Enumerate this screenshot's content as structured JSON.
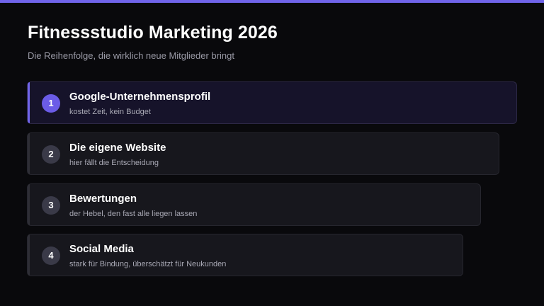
{
  "header": {
    "title": "Fitnessstudio Marketing 2026",
    "subtitle": "Die Reihenfolge, die wirklich neue Mitglieder bringt"
  },
  "steps": [
    {
      "number": "1",
      "title": "Google-Unternehmensprofil",
      "description": "kostet Zeit, kein Budget",
      "active": true
    },
    {
      "number": "2",
      "title": "Die eigene Website",
      "description": "hier fällt die Entscheidung",
      "active": false
    },
    {
      "number": "3",
      "title": "Bewertungen",
      "description": "der Hebel, den fast alle liegen lassen",
      "active": false
    },
    {
      "number": "4",
      "title": "Social Media",
      "description": "stark für Bindung, überschätzt für Neukunden",
      "active": false
    }
  ],
  "colors": {
    "accent": "#7064ea",
    "background": "#09090c",
    "card": "#17171d"
  }
}
